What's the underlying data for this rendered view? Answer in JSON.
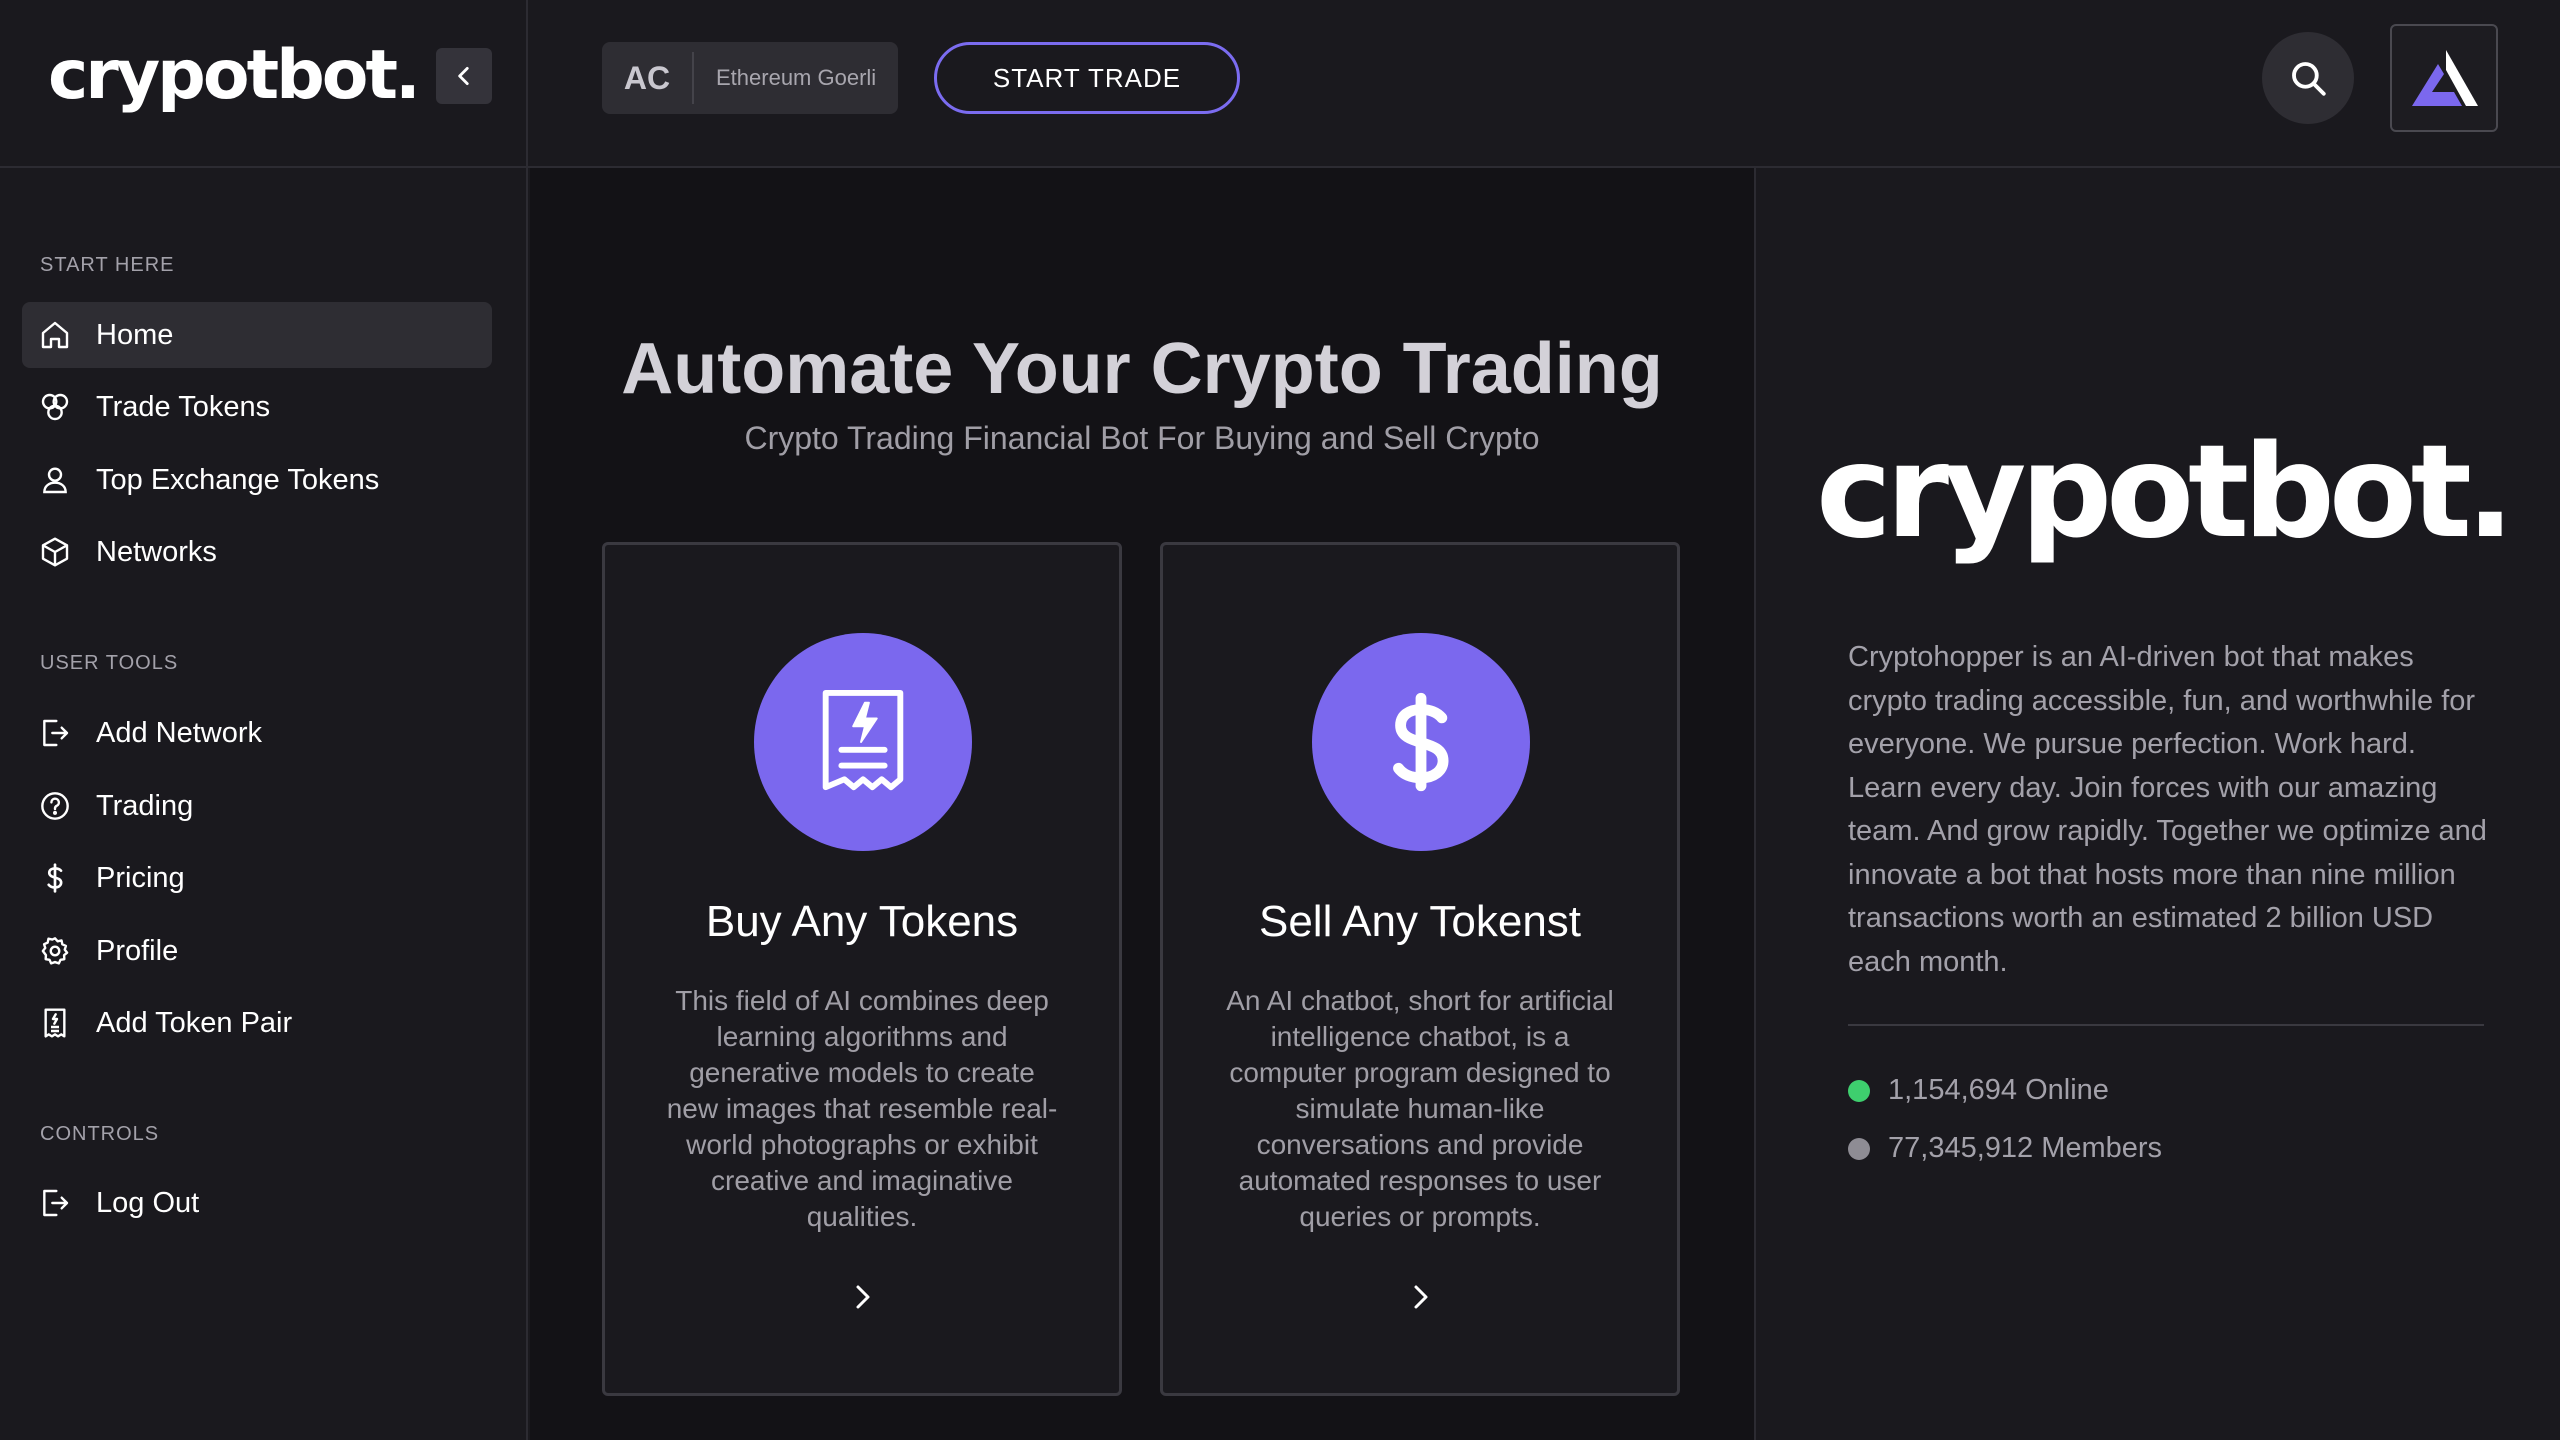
{
  "app": {
    "brand": "crypotbot."
  },
  "header": {
    "network_abbr": "AC",
    "network_name": "Ethereum Goerli",
    "start_trade_label": "START TRADE"
  },
  "sidebar": {
    "sections": [
      {
        "label": "START HERE",
        "items": [
          {
            "label": "Home",
            "icon": "home-icon",
            "active": true
          },
          {
            "label": "Trade Tokens",
            "icon": "coins-icon"
          },
          {
            "label": "Top Exchange Tokens",
            "icon": "user-icon"
          },
          {
            "label": "Networks",
            "icon": "cube-icon"
          }
        ]
      },
      {
        "label": "USER TOOLS",
        "items": [
          {
            "label": "Add Network",
            "icon": "log-in-icon"
          },
          {
            "label": "Trading",
            "icon": "help-circle-icon"
          },
          {
            "label": "Pricing",
            "icon": "dollar-icon"
          },
          {
            "label": "Profile",
            "icon": "gear-icon"
          },
          {
            "label": "Add Token Pair",
            "icon": "receipt-icon"
          }
        ]
      },
      {
        "label": "CONTROLS",
        "items": [
          {
            "label": "Log Out",
            "icon": "logout-icon"
          }
        ]
      }
    ]
  },
  "main": {
    "title": "Automate Your Crypto Trading",
    "subtitle": "Crypto Trading Financial Bot For Buying and Sell Crypto",
    "cards": [
      {
        "title": "Buy Any Tokens",
        "icon": "receipt-bolt-icon",
        "description": "This field of AI combines deep learning algorithms and generative models to create new images that resemble real-world photographs or exhibit creative and imaginative qualities."
      },
      {
        "title": "Sell Any Tokenst",
        "icon": "dollar-icon",
        "description": "An AI chatbot, short for artificial intelligence chatbot, is a computer program designed to simulate human-like conversations and provide automated responses to user queries or prompts."
      }
    ]
  },
  "right_panel": {
    "brand": "crypotbot.",
    "about": "Cryptohopper is an AI-driven bot that makes crypto trading accessible, fun, and worthwhile for everyone. We pursue perfection. Work hard. Learn every day. Join forces with our amazing team. And grow rapidly. Together we optimize and innovate a bot that hosts more than nine million transactions worth an estimated 2 billion USD each month.",
    "stats": [
      {
        "text": "1,154,694 Online",
        "color": "#3ecf6e"
      },
      {
        "text": "77,345,912 Members",
        "color": "#8e8c94"
      }
    ]
  },
  "colors": {
    "accent": "#7b68ee",
    "background": "#1a191e",
    "main_background": "#131216"
  }
}
